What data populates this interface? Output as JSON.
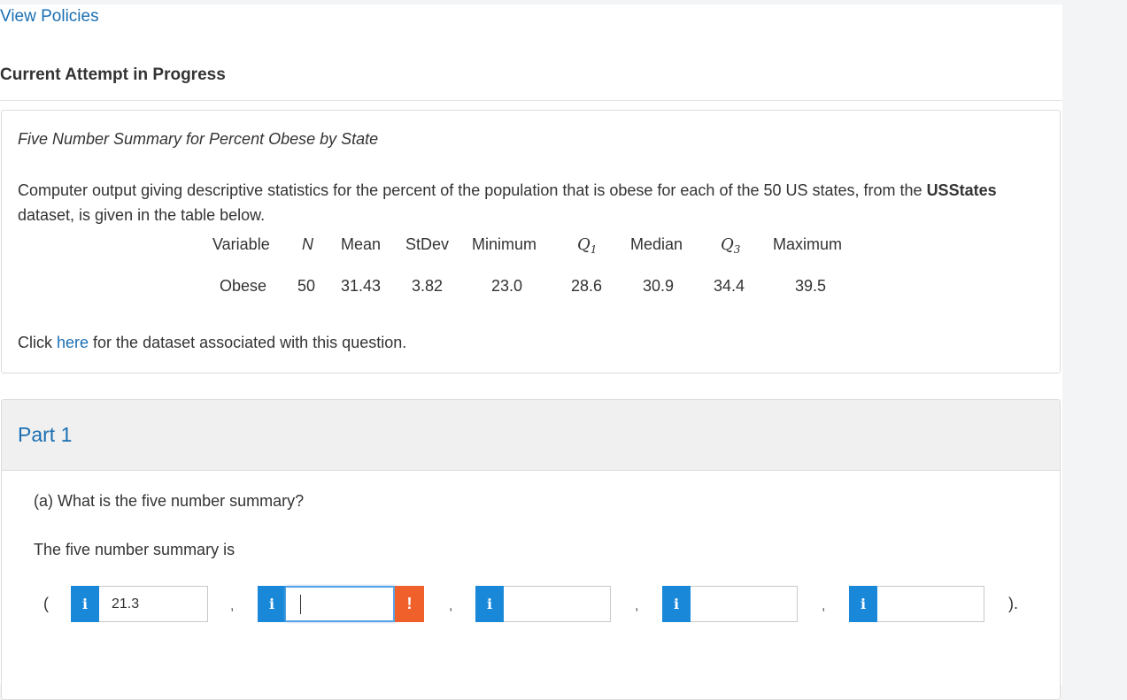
{
  "header": {
    "view_policies": "View Policies",
    "attempt_title": "Current Attempt in Progress"
  },
  "question": {
    "title": "Five Number Summary for Percent Obese by State",
    "text_before": "Computer output giving descriptive statistics for the percent of the population that is obese for each of the 50 US states, from the ",
    "dataset_name": "USStates",
    "text_after": " dataset, is given in the table below.",
    "click_prefix": "Click ",
    "click_link": "here",
    "click_suffix": " for the dataset associated with this question."
  },
  "stats_table": {
    "headers": {
      "variable": "Variable",
      "n": "N",
      "mean": "Mean",
      "stdev": "StDev",
      "minimum": "Minimum",
      "q1_main": "Q",
      "q1_sub": "1",
      "median": "Median",
      "q3_main": "Q",
      "q3_sub": "3",
      "maximum": "Maximum"
    },
    "row": {
      "variable": "Obese",
      "n": "50",
      "mean": "31.43",
      "stdev": "3.82",
      "minimum": "23.0",
      "q1": "28.6",
      "median": "30.9",
      "q3": "34.4",
      "maximum": "39.5"
    }
  },
  "part": {
    "label": "Part 1",
    "question": "(a) What is the five number summary?",
    "statement": "The five number summary is",
    "open_paren": "(",
    "close_paren": ").",
    "comma": ",",
    "info_symbol": "i",
    "warning_symbol": "!",
    "answers": [
      "21.3",
      "",
      "",
      "",
      ""
    ]
  }
}
